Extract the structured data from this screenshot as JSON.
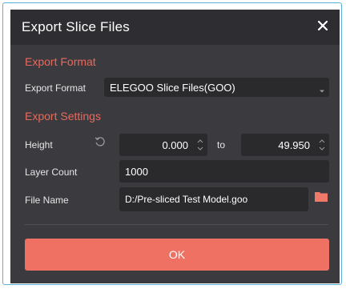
{
  "dialog": {
    "title": "Export Slice Files",
    "close_icon": "close-icon",
    "format_section": "Export Format",
    "format_label": "Export Format",
    "format_value": "ELEGOO Slice Files(GOO)",
    "settings_section": "Export Settings",
    "height_label": "Height",
    "height_from": "0.000",
    "to_label": "to",
    "height_to": "49.950",
    "layer_count_label": "Layer Count",
    "layer_count_value": "1000",
    "file_name_label": "File Name",
    "file_name_value": "D:/Pre-sliced Test Model.goo",
    "ok_label": "OK"
  },
  "colors": {
    "accent": "#ee7164",
    "section_title": "#e8695c",
    "folder_icon": "#f07a6a",
    "dialog_bg": "#3b3b3f",
    "titlebar_bg": "#2e2e32",
    "field_bg": "#2a2a2d"
  }
}
